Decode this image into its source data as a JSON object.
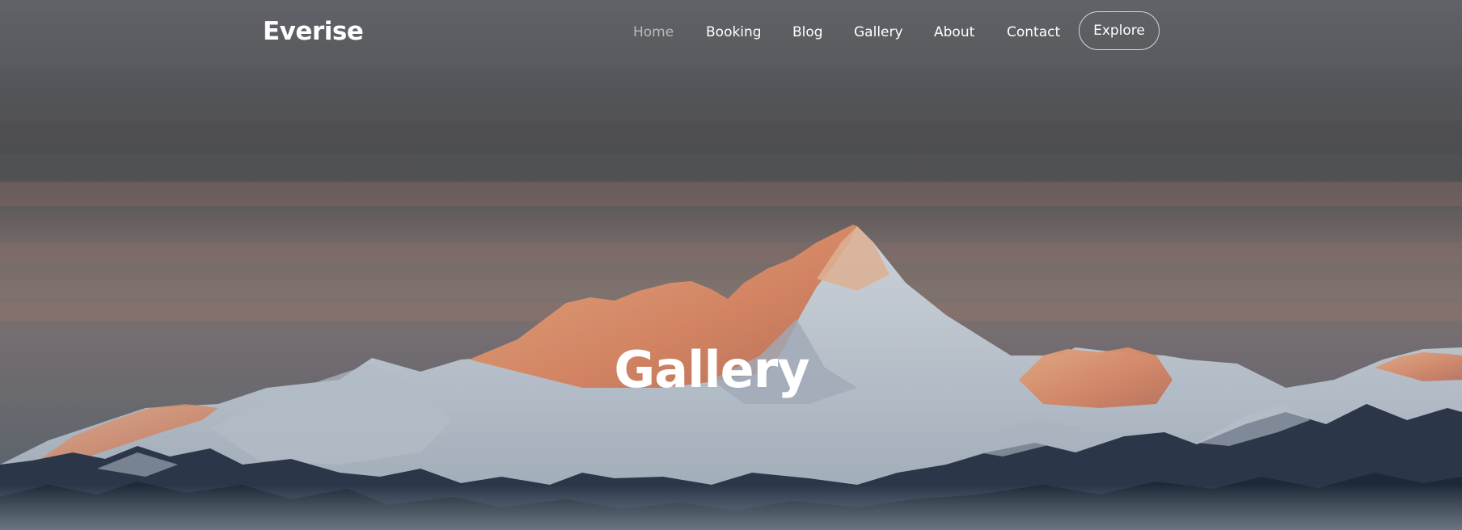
{
  "brand": {
    "name": "Everise"
  },
  "nav": {
    "items": [
      {
        "label": "Home",
        "active": true
      },
      {
        "label": "Booking",
        "active": false
      },
      {
        "label": "Blog",
        "active": false
      },
      {
        "label": "Gallery",
        "active": false
      },
      {
        "label": "About",
        "active": false
      },
      {
        "label": "Contact",
        "active": false
      }
    ],
    "cta_label": "Explore"
  },
  "hero": {
    "title": "Gallery",
    "background": "snowy-mountain-range-at-sunset"
  },
  "colors": {
    "text": "#ffffff",
    "nav_active": "#b9b9b9",
    "sky_top": "#5b5d62",
    "sky_glow": "#c9826f",
    "peak_lit": "#f0a078",
    "snow": "#cfd8e2",
    "rock": "#2c3a4d"
  }
}
